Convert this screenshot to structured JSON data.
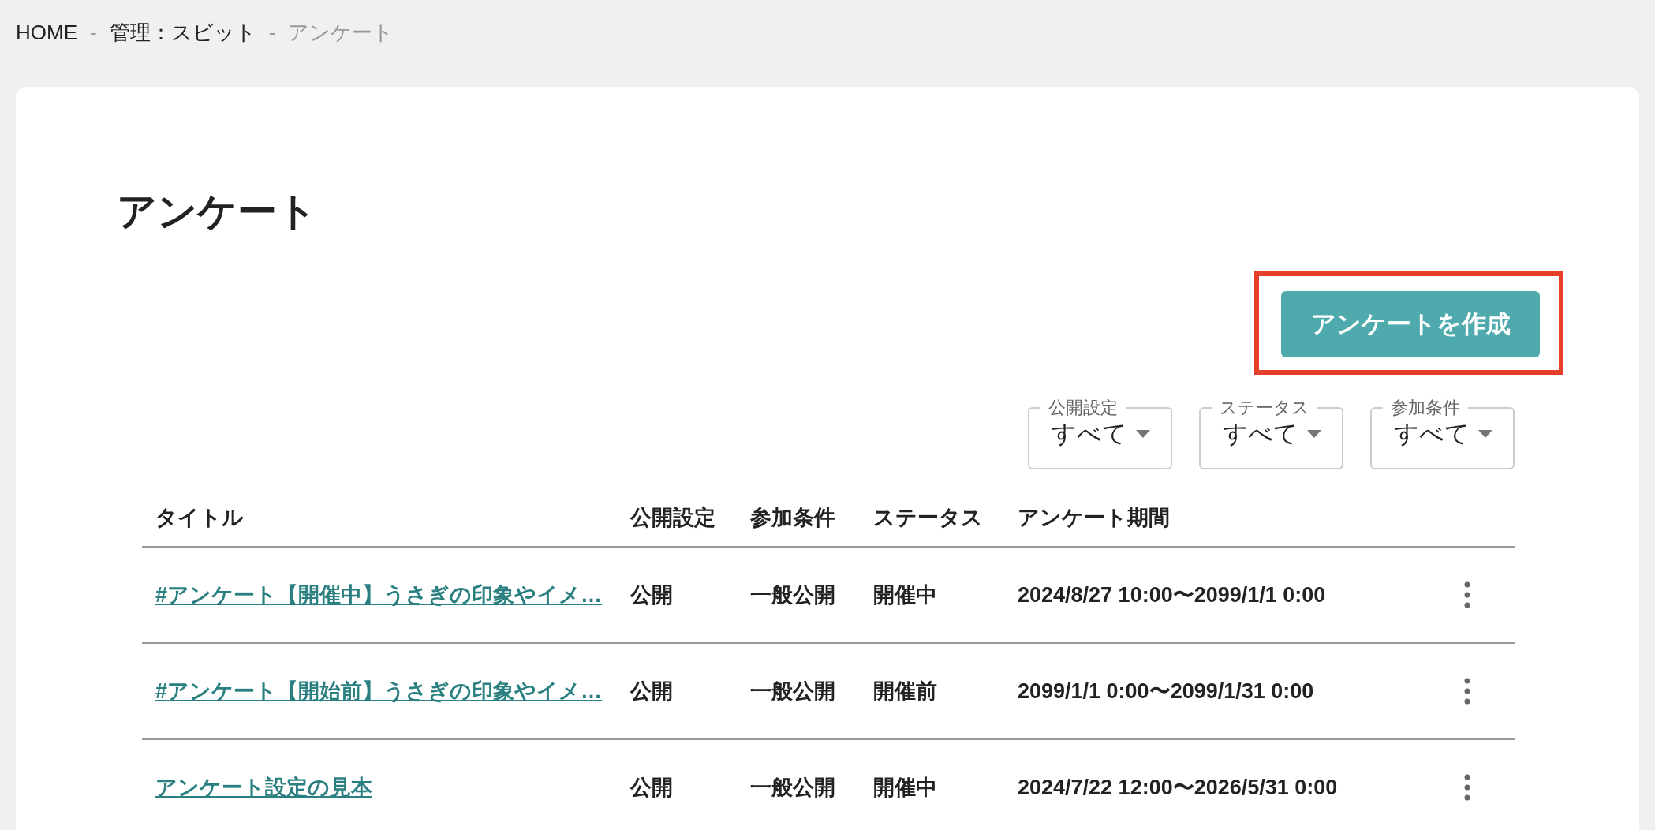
{
  "breadcrumb": {
    "items": [
      {
        "label": "HOME",
        "current": false
      },
      {
        "label": "管理：スビット",
        "current": false
      },
      {
        "label": "アンケート",
        "current": true
      }
    ],
    "separators": [
      "-",
      "-"
    ]
  },
  "page_title": "アンケート",
  "create_button": {
    "label": "アンケートを作成",
    "highlighted": true
  },
  "filters": [
    {
      "label": "公開設定",
      "value": "すべて"
    },
    {
      "label": "ステータス",
      "value": "すべて"
    },
    {
      "label": "参加条件",
      "value": "すべて"
    }
  ],
  "table": {
    "columns": [
      "タイトル",
      "公開設定",
      "参加条件",
      "ステータス",
      "アンケート期間"
    ],
    "rows": [
      {
        "title": "#アンケート【開催中】うさぎの印象やイメ…",
        "visibility": "公開",
        "condition": "一般公開",
        "status": "開催中",
        "period": "2024/8/27 10:00〜2099/1/1 0:00"
      },
      {
        "title": "#アンケート【開始前】うさぎの印象やイメ…",
        "visibility": "公開",
        "condition": "一般公開",
        "status": "開催前",
        "period": "2099/1/1 0:00〜2099/1/31 0:00"
      },
      {
        "title": "アンケート設定の見本",
        "visibility": "公開",
        "condition": "一般公開",
        "status": "開催中",
        "period": "2024/7/22 12:00〜2026/5/31 0:00"
      }
    ]
  }
}
